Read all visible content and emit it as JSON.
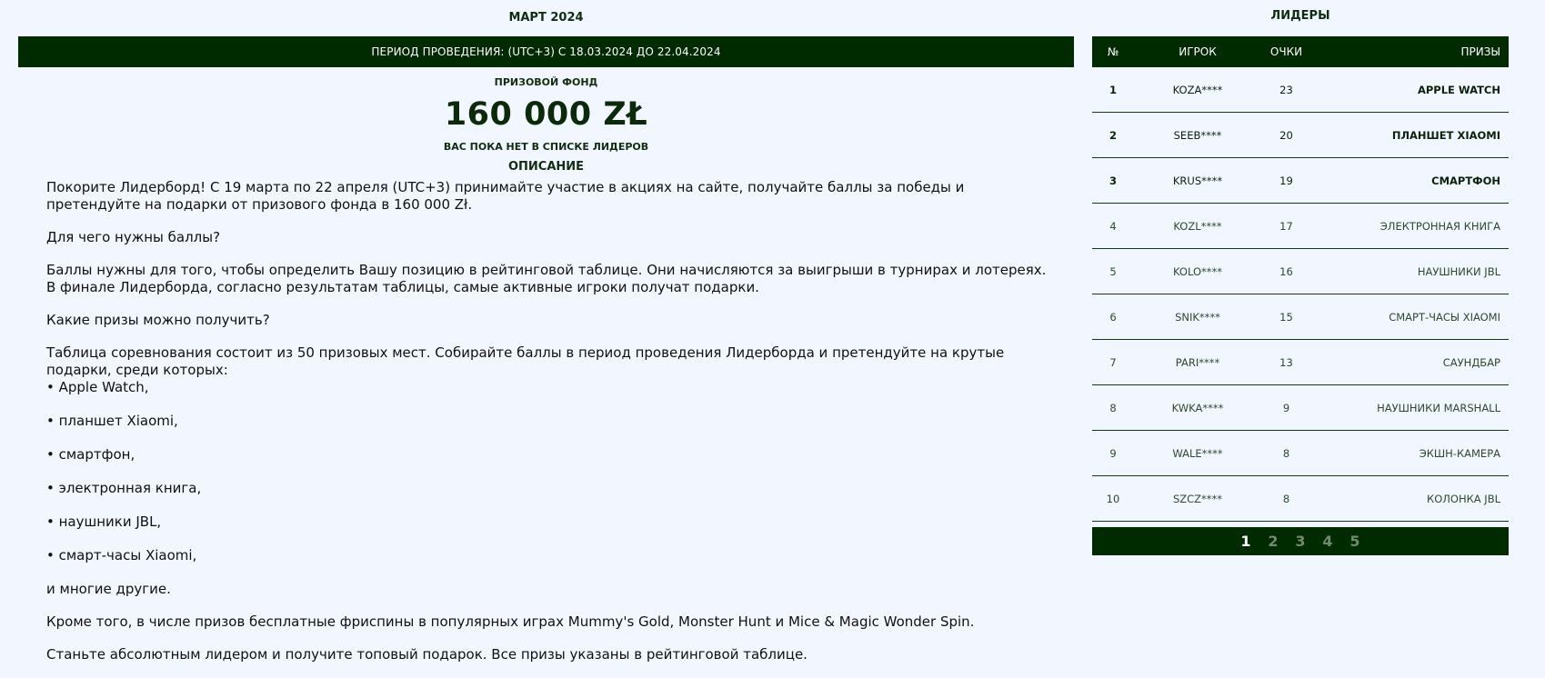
{
  "contest": {
    "month_title": "МАРТ 2024",
    "period": "ПЕРИОД ПРОВЕДЕНИЯ: (UTC+3) С 18.03.2024 ДО 22.04.2024",
    "prize_fund_label": "ПРИЗОВОЙ ФОНД",
    "prize_fund_amount": "160 000  ZŁ",
    "not_listed": "ВАС ПОКА НЕТ В СПИСКЕ ЛИДЕРОВ",
    "description_title": "ОПИСАНИЕ"
  },
  "description": {
    "intro": "Покорите Лидерборд! С 19 марта по 22 апреля (UTC+3) принимайте участие в акциях на сайте, получайте баллы за победы и претендуйте на подарки от призового фонда в 160 000 Zł.",
    "q1": "Для чего нужны баллы?",
    "a1": "Баллы нужны для того, чтобы определить Вашу позицию в рейтинговой таблице. Они начисляются за выигрыши в турнирах и лотереях. В финале Лидерборда, согласно результатам таблицы, самые активные игроки получат подарки.",
    "q2": "Какие призы можно получить?",
    "a2": "Таблица соревнования состоит из 50 призовых мест. Собирайте баллы в период проведения Лидерборда и претендуйте на крутые подарки, среди которых:",
    "bullets": [
      "• Apple Watch,",
      "• планшет Xiaomi,",
      "• смартфон,",
      "• электронная книга,",
      "• наушники JBL,",
      "• смарт-часы Xiaomi,"
    ],
    "others": "и многие другие.",
    "freespins": "Кроме того, в числе призов бесплатные фриспины в популярных играх Mummy's Gold, Monster Hunt и Mice & Magic Wonder Spin.",
    "final": "Станьте абсолютным лидером и получите топовый подарок. Все призы указаны в рейтинговой таблице."
  },
  "leaderboard": {
    "title": "ЛИДЕРЫ",
    "headers": {
      "rank": "№",
      "player": "ИГРОК",
      "points": "ОЧКИ",
      "prize": "ПРИЗЫ"
    },
    "rows": [
      {
        "rank": "1",
        "player": "KOZA****",
        "points": "23",
        "prize": "APPLE WATCH"
      },
      {
        "rank": "2",
        "player": "SEEB****",
        "points": "20",
        "prize": "ПЛАНШЕТ XIAOMI"
      },
      {
        "rank": "3",
        "player": "KRUS****",
        "points": "19",
        "prize": "СМАРТФОН"
      },
      {
        "rank": "4",
        "player": "KOZL****",
        "points": "17",
        "prize": "ЭЛЕКТРОННАЯ КНИГА"
      },
      {
        "rank": "5",
        "player": "KOLO****",
        "points": "16",
        "prize": "НАУШНИКИ JBL"
      },
      {
        "rank": "6",
        "player": "SNIK****",
        "points": "15",
        "prize": "СМАРТ-ЧАСЫ XIAOMI"
      },
      {
        "rank": "7",
        "player": "PARI****",
        "points": "13",
        "prize": "САУНДБАР"
      },
      {
        "rank": "8",
        "player": "KWKA****",
        "points": "9",
        "prize": "НАУШНИКИ MARSHALL"
      },
      {
        "rank": "9",
        "player": "WALE****",
        "points": "8",
        "prize": "ЭКШН-КАМЕРА"
      },
      {
        "rank": "10",
        "player": "SZCZ****",
        "points": "8",
        "prize": "КОЛОНКА JBL"
      }
    ],
    "pages": [
      "1",
      "2",
      "3",
      "4",
      "5"
    ],
    "current_page": "1"
  },
  "colors": {
    "dark_green": "#002a00",
    "background": "#f2f6ff"
  }
}
